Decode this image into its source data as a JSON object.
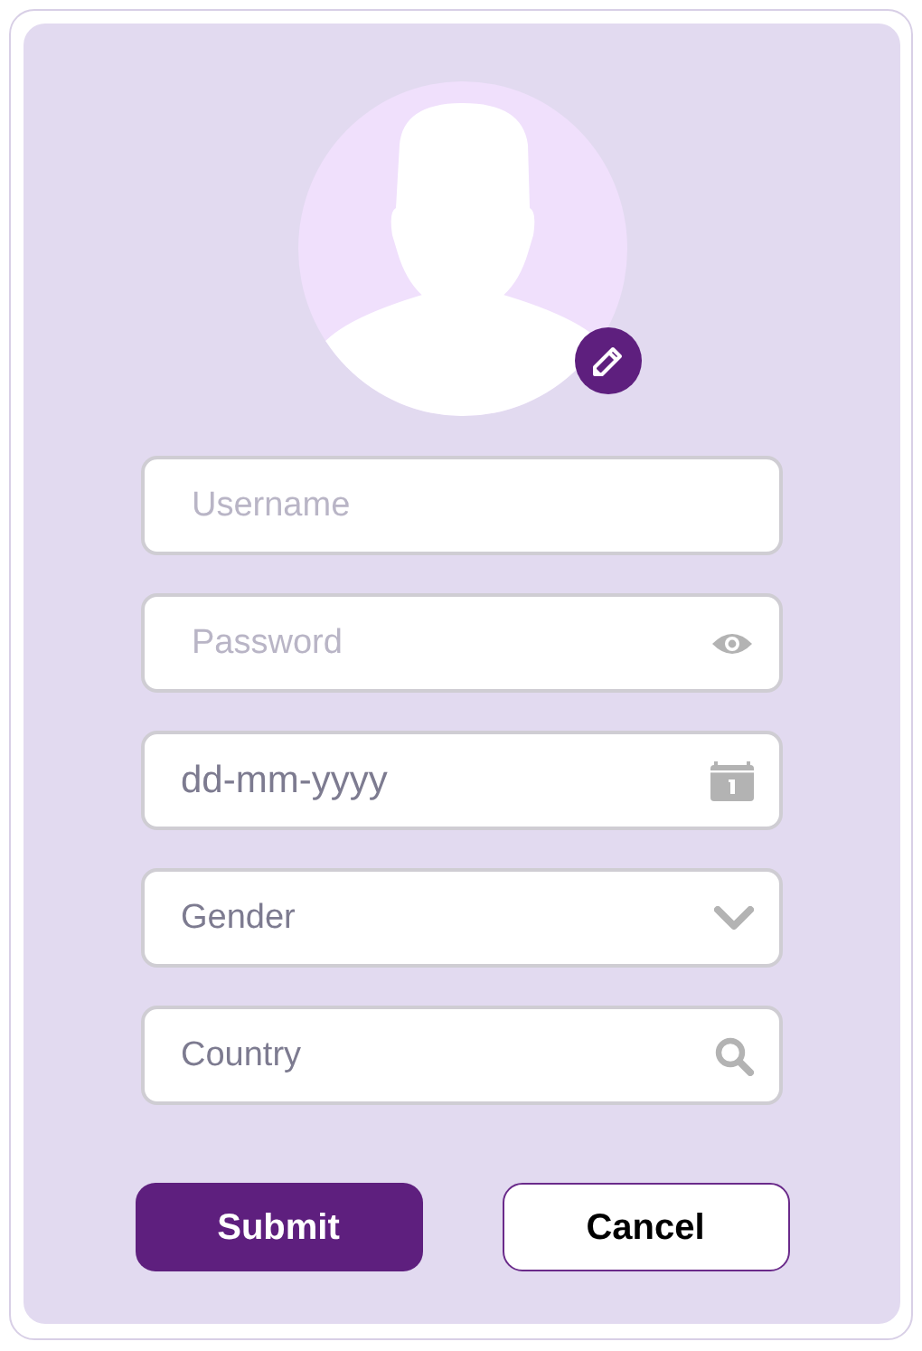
{
  "avatar": {
    "editable": true
  },
  "fields": [
    {
      "kind": "text",
      "placeholder": "Username"
    },
    {
      "kind": "password",
      "placeholder": "Password"
    },
    {
      "kind": "date",
      "placeholder": "dd-mm-yyyy"
    },
    {
      "kind": "select",
      "placeholder": "Gender"
    },
    {
      "kind": "search",
      "placeholder": "Country"
    }
  ],
  "buttons": [
    {
      "kind": "primary",
      "label": "Submit"
    },
    {
      "kind": "secondary",
      "label": "Cancel"
    }
  ]
}
